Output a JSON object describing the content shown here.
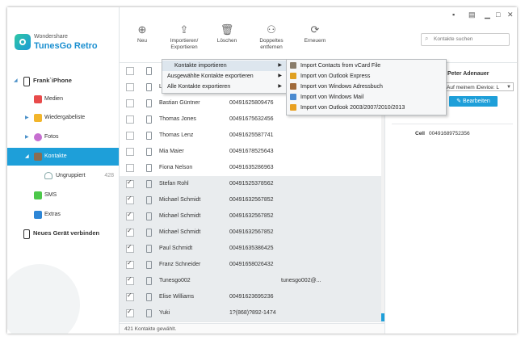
{
  "app": {
    "brand_small": "Wondershare",
    "brand_name": "TunesGo Retro"
  },
  "window_controls": [
    "chat-icon",
    "menu-icon",
    "minimize-icon",
    "maximize-icon",
    "close-icon"
  ],
  "toolbar": {
    "new": "Neu",
    "import_export_1": "Importieren/",
    "import_export_2": "Exportieren",
    "delete": "Löschen",
    "dupes_1": "Doppeltes",
    "dupes_2": "entfernen",
    "refresh": "Erneuern",
    "search_placeholder": "Kontakte suchen"
  },
  "sidebar": {
    "device": "Frank`iPhone",
    "items": [
      {
        "label": "Medien",
        "icon": "media-icon",
        "color": "#e84b4b"
      },
      {
        "label": "Wiedergabeliste",
        "icon": "playlist-icon",
        "color": "#f2b52b"
      },
      {
        "label": "Fotos",
        "icon": "photos-icon",
        "color": "#c66fd0"
      },
      {
        "label": "Kontakte",
        "icon": "contacts-icon",
        "color": "#8a6d52"
      },
      {
        "label": "Ungruppiert",
        "count": "428",
        "icon": "group-icon"
      },
      {
        "label": "SMS",
        "icon": "sms-icon",
        "color": "#4cc84a"
      },
      {
        "label": "Extras",
        "icon": "extras-icon",
        "color": "#2d86d6"
      }
    ],
    "connect": "Neues Gerät verbinden"
  },
  "accent": "#1e9fd9",
  "contacts": [
    {
      "name": "",
      "phone": "",
      "email": "",
      "checked": false
    },
    {
      "name": "L",
      "phone": "",
      "email": "",
      "checked": false
    },
    {
      "name": "Bastian  Güntner",
      "phone": "00491625809476",
      "email": "",
      "checked": false
    },
    {
      "name": "Thomas  Jones",
      "phone": "00491675632456",
      "email": "",
      "checked": false
    },
    {
      "name": "Thomas  Lenz",
      "phone": "00491625587741",
      "email": "",
      "checked": false
    },
    {
      "name": "Mia  Maier",
      "phone": "00491678525643",
      "email": "",
      "checked": false
    },
    {
      "name": "Fiona  Nelson",
      "phone": "00491635286963",
      "email": "",
      "checked": false
    },
    {
      "name": "Stefan  Rohl",
      "phone": "00491525378562",
      "email": "",
      "checked": true
    },
    {
      "name": "Michael  Schmidt",
      "phone": "00491632567852",
      "email": "",
      "checked": true
    },
    {
      "name": "Michael  Schmidt",
      "phone": "00491632567852",
      "email": "",
      "checked": true
    },
    {
      "name": "Michael  Schmidt",
      "phone": "00491632567852",
      "email": "",
      "checked": true
    },
    {
      "name": "Paul  Schmidt",
      "phone": "00491635386425",
      "email": "",
      "checked": true
    },
    {
      "name": "Franz  Schneider",
      "phone": "00491658026432",
      "email": "",
      "checked": true
    },
    {
      "name": "Tunesgo002",
      "phone": "",
      "email": "tunesgo002@...",
      "checked": true
    },
    {
      "name": "Elise  Williams",
      "phone": "00491623695236",
      "email": "",
      "checked": true
    },
    {
      "name": "Yuki",
      "phone": "1?(868)?892-1474",
      "email": "",
      "checked": true
    }
  ],
  "status": "421 Kontakte gewählt.",
  "detail": {
    "name": "Peter  Adenauer",
    "location": "Auf meinem iDevice: L",
    "edit": "Bearbeiten",
    "cell_label": "Cell",
    "cell_value": "00491689752356"
  },
  "menu": {
    "items": [
      {
        "label": "Kontakte importieren",
        "has_sub": true,
        "highlighted": true
      },
      {
        "label": "Ausgewählte Kontakte exportieren",
        "has_sub": true
      },
      {
        "label": "Alle Kontakte exportieren",
        "has_sub": true
      }
    ],
    "submenu": [
      {
        "label": "Import Contacts from vCard File",
        "icon": "vcard-icon",
        "color": "#8a7d6a"
      },
      {
        "label": "Import von Outlook Express",
        "icon": "outlook-express-icon",
        "color": "#e0a020"
      },
      {
        "label": "Import von Windows Adressbuch",
        "icon": "address-book-icon",
        "color": "#a06a3a"
      },
      {
        "label": "Import von Windows Mail",
        "icon": "windows-mail-icon",
        "color": "#4a8ad0"
      },
      {
        "label": "Import von Outlook 2003/2007/2010/2013",
        "icon": "outlook-icon",
        "color": "#e8a020"
      }
    ]
  }
}
